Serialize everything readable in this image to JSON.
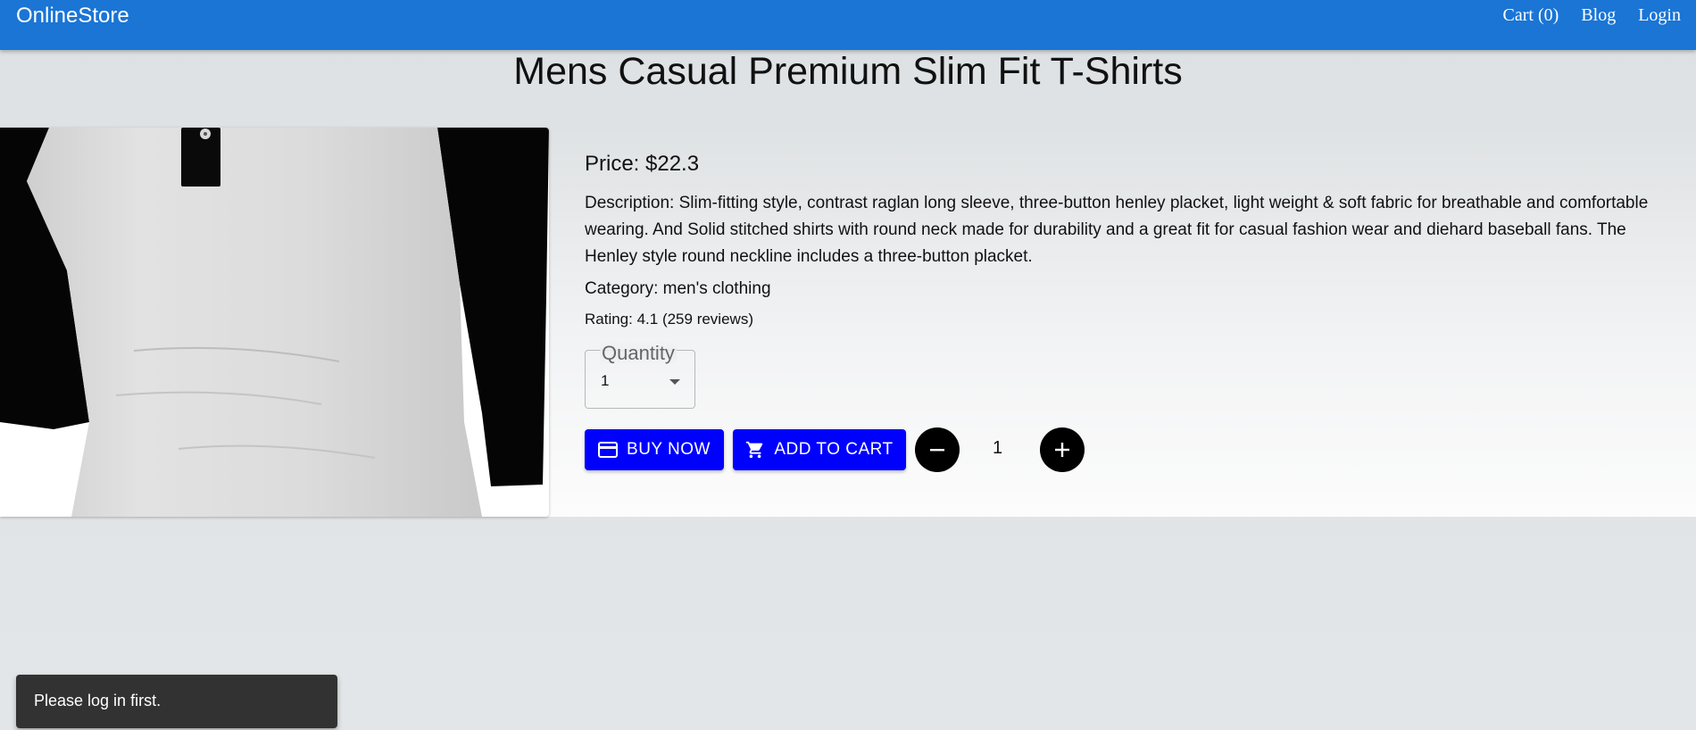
{
  "header": {
    "brand": "OnlineStore",
    "nav": {
      "cart": "Cart (0)",
      "blog": "Blog",
      "login": "Login"
    },
    "color": "#1a75d5"
  },
  "product": {
    "title": "Mens Casual Premium Slim Fit T-Shirts",
    "price": "Price: $22.3",
    "description": "Description: Slim-fitting style, contrast raglan long sleeve, three-button henley placket, light weight & soft fabric for breathable and comfortable wearing. And Solid stitched shirts with round neck made for durability and a great fit for casual fashion wear and diehard baseball fans. The Henley style round neckline includes a three-button placket.",
    "category": "Category: men's clothing",
    "rating": "Rating: 4.1 (259 reviews)",
    "image_icon": "henley-tshirt-image"
  },
  "quantity_select": {
    "label": "Quantity",
    "value": "1"
  },
  "actions": {
    "buy_now": "BUY NOW",
    "add_to_cart": "ADD TO CART",
    "counter": "1",
    "button_color": "#0000ff"
  },
  "icons": {
    "buy_now": "credit-card-icon",
    "add_to_cart": "shopping-cart-icon",
    "decrement": "minus-icon",
    "increment": "plus-icon",
    "select": "caret-down-icon"
  },
  "snackbar": {
    "message": "Please log in first."
  }
}
